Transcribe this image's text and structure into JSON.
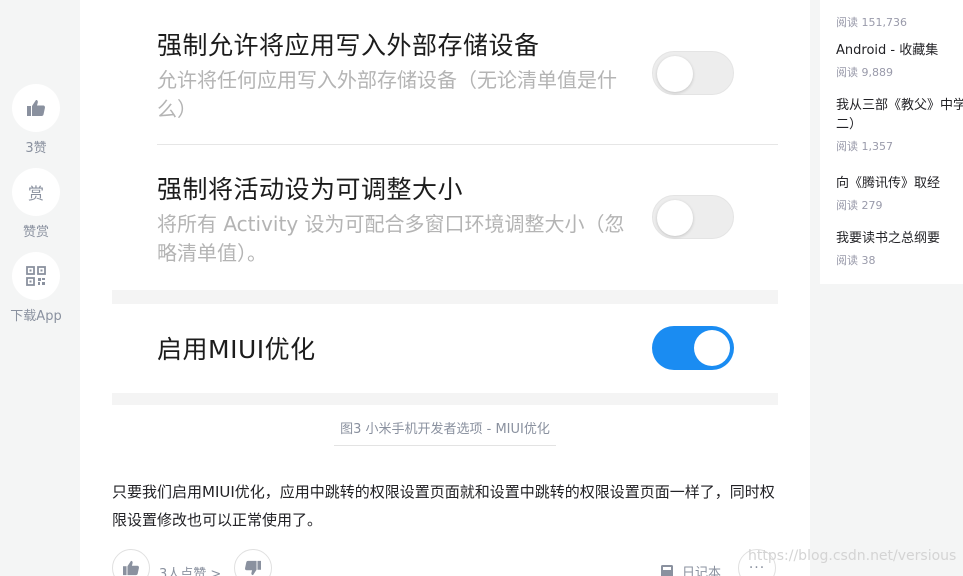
{
  "sidebar": {
    "like": {
      "icon": "thumbs-up-icon",
      "label": "3赞"
    },
    "reward": {
      "icon_text": "赏",
      "label": "赞赏"
    },
    "download": {
      "icon": "qr-code-icon",
      "label": "下载App"
    }
  },
  "figure": {
    "settings": [
      {
        "title": "强制允许将应用写入外部存储设备",
        "description": "允许将任何应用写入外部存储设备（无论清单值是什么）",
        "enabled": false
      },
      {
        "title": "强制将活动设为可调整大小",
        "description": "将所有 Activity 设为可配合多窗口环境调整大小（忽略清单值）。",
        "enabled": false
      },
      {
        "title": "启用MIUI优化",
        "enabled": true
      }
    ],
    "caption": "图3 小米手机开发者选项 - MIUI优化"
  },
  "article": {
    "paragraph": "只要我们启用MIUI优化，应用中跳转的权限设置页面就和设置中跳转的权限设置页面一样了，同时权限设置修改也可以正常使用了。"
  },
  "bottom_bar": {
    "like_count": "3人点赞 >",
    "notebook": "日记本",
    "more": "···"
  },
  "right_col": {
    "items": [
      {
        "title": "",
        "read": "阅读 151,736"
      },
      {
        "title": "Android - 收藏集",
        "read": "阅读 9,889"
      },
      {
        "title": "我从三部《教父》中学",
        "title2": "二）",
        "read": "阅读 1,357"
      },
      {
        "title": "向《腾讯传》取经",
        "read": "阅读 279"
      },
      {
        "title": "我要读书之总纲要",
        "read": "阅读 38"
      }
    ]
  },
  "watermark": "https://blog.csdn.net/versious",
  "colors": {
    "toggle_on": "#1a8cf2",
    "toggle_off": "#ededed",
    "muted_text": "#8a919f"
  }
}
